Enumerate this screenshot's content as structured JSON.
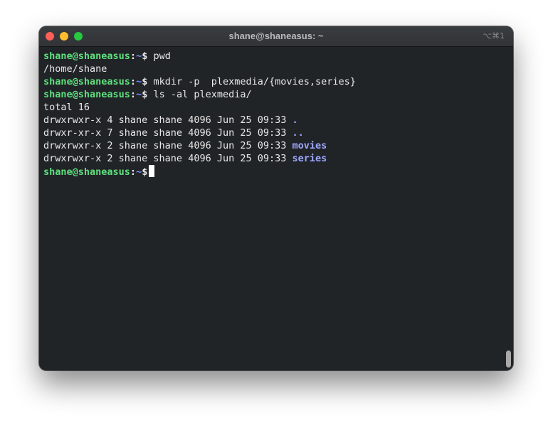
{
  "window": {
    "title": "shane@shaneasus: ~",
    "shortcut": "⌥⌘1"
  },
  "prompt": {
    "user_host": "shane@shaneasus",
    "separator": ":",
    "path": "~",
    "symbol": "$"
  },
  "lines": [
    {
      "type": "command",
      "text": " pwd"
    },
    {
      "type": "output",
      "text": "/home/shane"
    },
    {
      "type": "command",
      "text": " mkdir -p  plexmedia/{movies,series}"
    },
    {
      "type": "command",
      "text": " ls -al plexmedia/"
    },
    {
      "type": "output",
      "text": "total 16"
    },
    {
      "type": "listing",
      "perms": "drwxrwxr-x 4 shane shane 4096 Jun 25 09:33 ",
      "name": "."
    },
    {
      "type": "listing",
      "perms": "drwxr-xr-x 7 shane shane 4096 Jun 25 09:33 ",
      "name": ".."
    },
    {
      "type": "listing",
      "perms": "drwxrwxr-x 2 shane shane 4096 Jun 25 09:33 ",
      "name": "movies"
    },
    {
      "type": "listing",
      "perms": "drwxrwxr-x 2 shane shane 4096 Jun 25 09:33 ",
      "name": "series"
    }
  ],
  "colors": {
    "prompt": "#5ee07e",
    "path": "#7b8cff",
    "directory": "#9ea7ff",
    "background": "#212427"
  }
}
